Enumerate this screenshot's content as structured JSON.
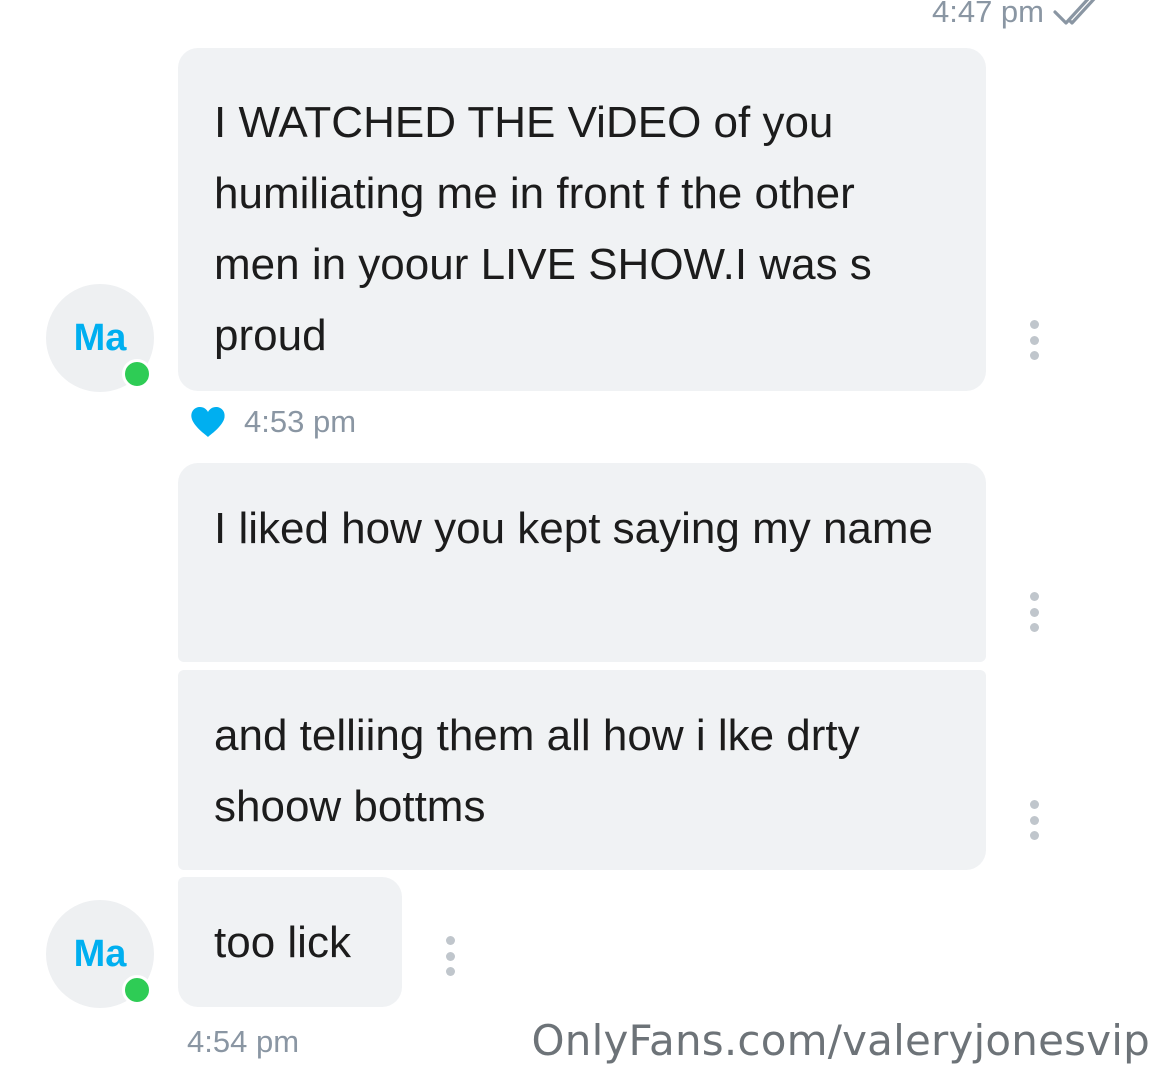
{
  "top_status": {
    "time": "4:47 pm",
    "read_icon": "double-check-icon"
  },
  "messages": [
    {
      "text": "I WATCHED THE ViDEO of you humiliating me in front f the other men in yoour LIVE SHOW.I was s proud",
      "options_icon": "more-vertical-icon"
    },
    {
      "text": "I liked how you kept saying my name",
      "options_icon": "more-vertical-icon"
    },
    {
      "text": "and telliing them all how i lke drty shoow bottms",
      "options_icon": "more-vertical-icon"
    },
    {
      "text": "too lick",
      "options_icon": "more-vertical-icon"
    }
  ],
  "avatars": [
    {
      "initials": "Ma",
      "status": "online"
    },
    {
      "initials": "Ma",
      "status": "online"
    }
  ],
  "meta": {
    "liked_icon": "heart-icon",
    "time_1": "4:53 pm",
    "time_2": "4:54 pm"
  },
  "watermark": "OnlyFans.com/valeryjonesvip",
  "colors": {
    "accent": "#00aff0",
    "bubble": "#f0f2f4",
    "online": "#2ecc55",
    "meta_text": "#8a96a3"
  }
}
